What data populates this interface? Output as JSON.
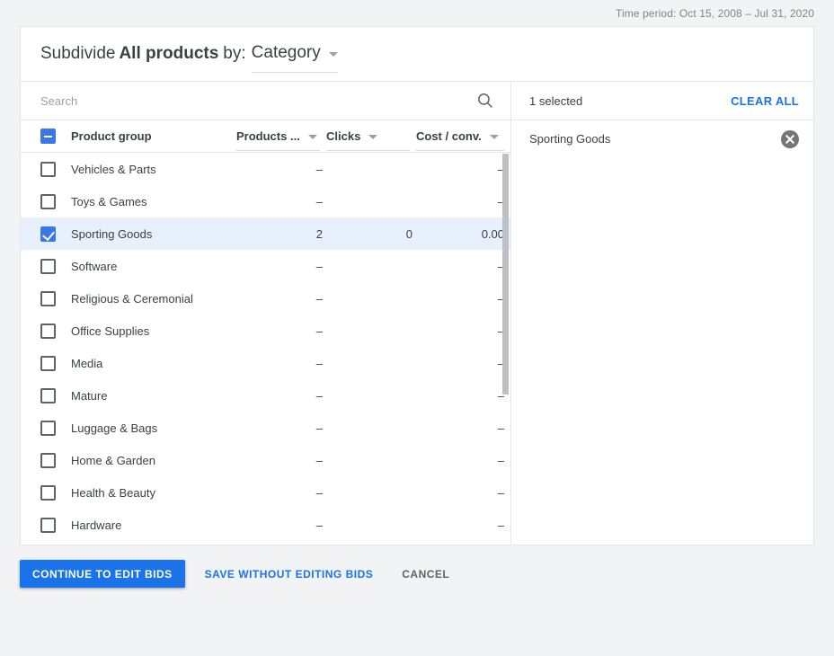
{
  "time_period": {
    "label": "Time period:",
    "range": "Oct 15, 2008 – Jul 31, 2020",
    "full": "Time period: Oct 15, 2008 – Jul 31, 2020"
  },
  "dialog": {
    "title_prefix": "Subdivide",
    "title_subject": "All products",
    "title_by": "by:",
    "subdivide_by_value": "Category",
    "caret_icon": "chevron-down-icon"
  },
  "search": {
    "value": "",
    "placeholder": "Search",
    "icon": "search-icon"
  },
  "table": {
    "header_checkbox_state": "indeterminate",
    "columns": [
      {
        "key": "name",
        "label": "Product group",
        "align": "left",
        "sortable": false
      },
      {
        "key": "c1",
        "label": "Products ...",
        "align": "right",
        "sortable": true
      },
      {
        "key": "c2",
        "label": "Clicks",
        "align": "right",
        "sortable": true
      },
      {
        "key": "c3",
        "label": "Cost / conv.",
        "align": "right",
        "sortable": true
      }
    ],
    "rows": [
      {
        "name": "Vehicles & Parts",
        "checked": false,
        "selected": false,
        "c1": "–",
        "c2": "",
        "c3": "–"
      },
      {
        "name": "Toys & Games",
        "checked": false,
        "selected": false,
        "c1": "–",
        "c2": "",
        "c3": "–"
      },
      {
        "name": "Sporting Goods",
        "checked": true,
        "selected": true,
        "c1": "2",
        "c2": "0",
        "c3": "0.00"
      },
      {
        "name": "Software",
        "checked": false,
        "selected": false,
        "c1": "–",
        "c2": "",
        "c3": "–"
      },
      {
        "name": "Religious & Ceremonial",
        "checked": false,
        "selected": false,
        "c1": "–",
        "c2": "",
        "c3": "–"
      },
      {
        "name": "Office Supplies",
        "checked": false,
        "selected": false,
        "c1": "–",
        "c2": "",
        "c3": "–"
      },
      {
        "name": "Media",
        "checked": false,
        "selected": false,
        "c1": "–",
        "c2": "",
        "c3": "–"
      },
      {
        "name": "Mature",
        "checked": false,
        "selected": false,
        "c1": "–",
        "c2": "",
        "c3": "–"
      },
      {
        "name": "Luggage & Bags",
        "checked": false,
        "selected": false,
        "c1": "–",
        "c2": "",
        "c3": "–"
      },
      {
        "name": "Home & Garden",
        "checked": false,
        "selected": false,
        "c1": "–",
        "c2": "",
        "c3": "–"
      },
      {
        "name": "Health & Beauty",
        "checked": false,
        "selected": false,
        "c1": "–",
        "c2": "",
        "c3": "–"
      },
      {
        "name": "Hardware",
        "checked": false,
        "selected": false,
        "c1": "–",
        "c2": "",
        "c3": "–"
      }
    ]
  },
  "selection_panel": {
    "count_label": "1 selected",
    "clear_all_label": "CLEAR ALL",
    "items": [
      {
        "label": "Sporting Goods",
        "remove_icon": "close-circle-icon"
      }
    ]
  },
  "footer": {
    "primary_label": "CONTINUE TO EDIT BIDS",
    "secondary_label": "SAVE WITHOUT EDITING BIDS",
    "cancel_label": "CANCEL"
  },
  "colors": {
    "accent": "#1a73e8",
    "checkbox_blue": "#3b78e7",
    "selected_row": "#e8f0fe",
    "page_background": "#f1f3f4",
    "text": "#3c4043",
    "muted_text": "#80868b",
    "border": "#e4e6e8",
    "scrollbar": "#bdc1c6",
    "remove_icon": "#757575"
  }
}
